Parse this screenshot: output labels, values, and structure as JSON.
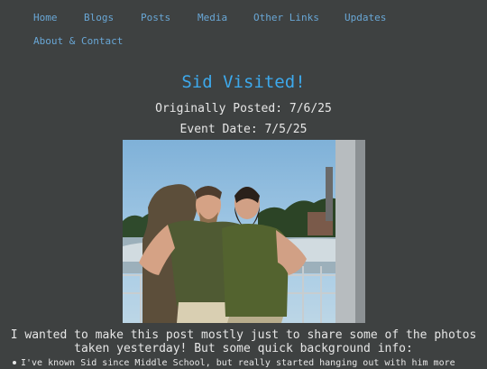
{
  "nav": {
    "items": [
      {
        "label": "Home"
      },
      {
        "label": "Blogs"
      },
      {
        "label": "Posts"
      },
      {
        "label": "Media"
      },
      {
        "label": "Other Links"
      },
      {
        "label": "Updates"
      },
      {
        "label": "About & Contact"
      }
    ]
  },
  "post": {
    "title": "Sid Visited!",
    "posted_line": "Originally Posted: 7/6/25",
    "event_line": "Event Date: 7/5/25",
    "intro_line1": "I wanted to make this post mostly just to share some of the photos",
    "intro_line2": "taken yesterday! But some quick background info:",
    "bullets": [
      {
        "text": "I've known Sid since Middle School, but really started hanging out with him more"
      }
    ]
  },
  "colors": {
    "background": "#3e4141",
    "link": "#69a7d6",
    "title": "#3da9ec",
    "text": "#e6e6e6"
  }
}
